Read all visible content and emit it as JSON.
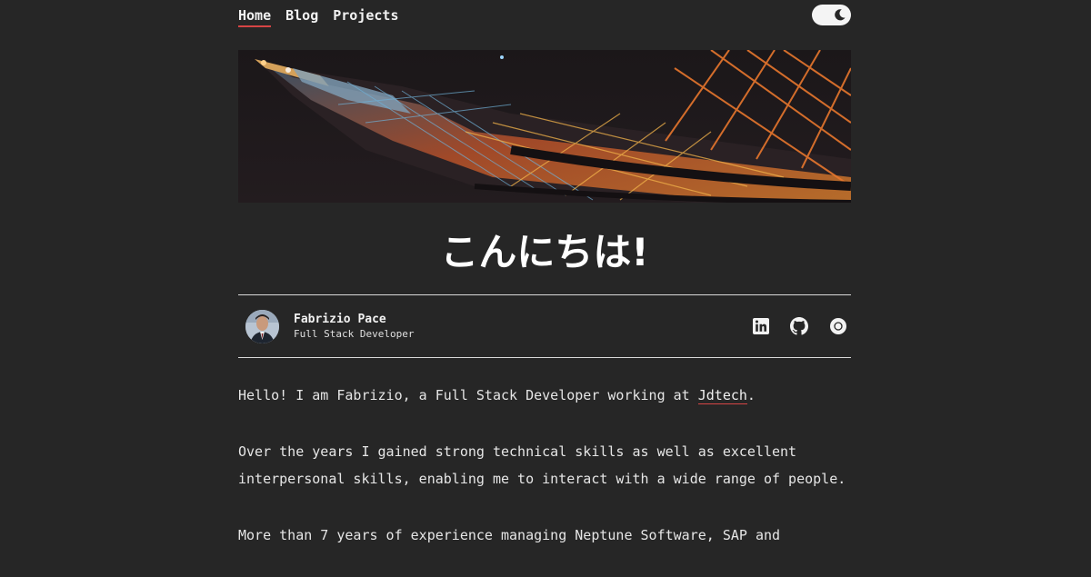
{
  "nav": {
    "items": [
      {
        "label": "Home",
        "active": true
      },
      {
        "label": "Blog",
        "active": false
      },
      {
        "label": "Projects",
        "active": false
      }
    ],
    "theme_toggle_icon": "moon-icon"
  },
  "hero": {
    "image": "tokyo-tower-night-photo"
  },
  "title": "こんにちは!",
  "author": {
    "name": "Fabrizio Pace",
    "role": "Full Stack Developer",
    "social": [
      {
        "icon": "linkedin-icon"
      },
      {
        "icon": "github-icon"
      },
      {
        "icon": "website-icon"
      }
    ]
  },
  "content": {
    "p1_before": "Hello! I am Fabrizio, a Full Stack Developer working at ",
    "p1_link": "Jdtech",
    "p1_after": ".",
    "p2": "Over the years I gained strong technical skills as well as excellent interpersonal skills, enabling me to interact with a wide range of people.",
    "p3": "More than 7 years of experience managing Neptune Software, SAP and"
  },
  "colors": {
    "background": "#262626",
    "accent": "#d64545",
    "text": "#e6e6e6"
  }
}
